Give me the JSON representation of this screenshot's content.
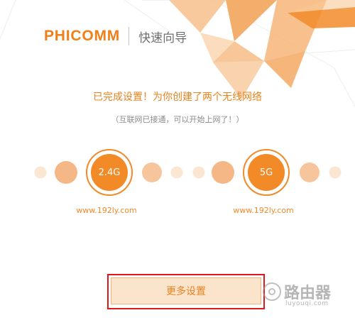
{
  "brand": {
    "name": "PHICOMM",
    "subtitle": "快速向导"
  },
  "message": {
    "title": "已完成设置！为你创建了两个无线网络",
    "subtitle": "（互联网已接通，可以开始上网了！）"
  },
  "networks": [
    {
      "band": "2.4G",
      "url": "www.192ly.com"
    },
    {
      "band": "5G",
      "url": "www.192ly.com"
    }
  ],
  "actions": {
    "more_settings": "更多设置"
  },
  "watermark": {
    "title": "路由器",
    "url": "luyouqi.com"
  },
  "colors": {
    "accent": "#f28a28",
    "accent_light": "#fbe4cc",
    "highlight_border": "#e0161b",
    "text_gray": "#8a8a8a"
  }
}
